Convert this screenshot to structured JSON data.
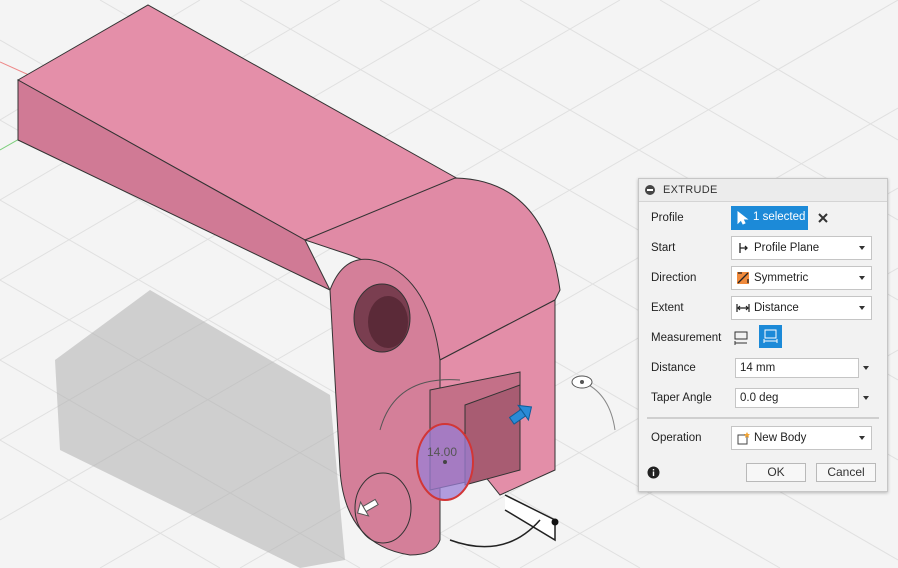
{
  "viewport": {
    "dimension_label": "14.00"
  },
  "panel": {
    "title": "EXTRUDE",
    "profile": {
      "label": "Profile",
      "selection": "1 selected"
    },
    "start": {
      "label": "Start",
      "value": "Profile Plane"
    },
    "direction": {
      "label": "Direction",
      "value": "Symmetric"
    },
    "extent": {
      "label": "Extent",
      "value": "Distance"
    },
    "measurement": {
      "label": "Measurement"
    },
    "distance": {
      "label": "Distance",
      "value": "14 mm"
    },
    "taper": {
      "label": "Taper Angle",
      "value": "0.0 deg"
    },
    "operation": {
      "label": "Operation",
      "value": "New Body"
    },
    "ok_label": "OK",
    "cancel_label": "Cancel"
  },
  "colors": {
    "part": "#e48fa9",
    "accent": "#1c8ad8",
    "selection": "#9b7fd6"
  }
}
